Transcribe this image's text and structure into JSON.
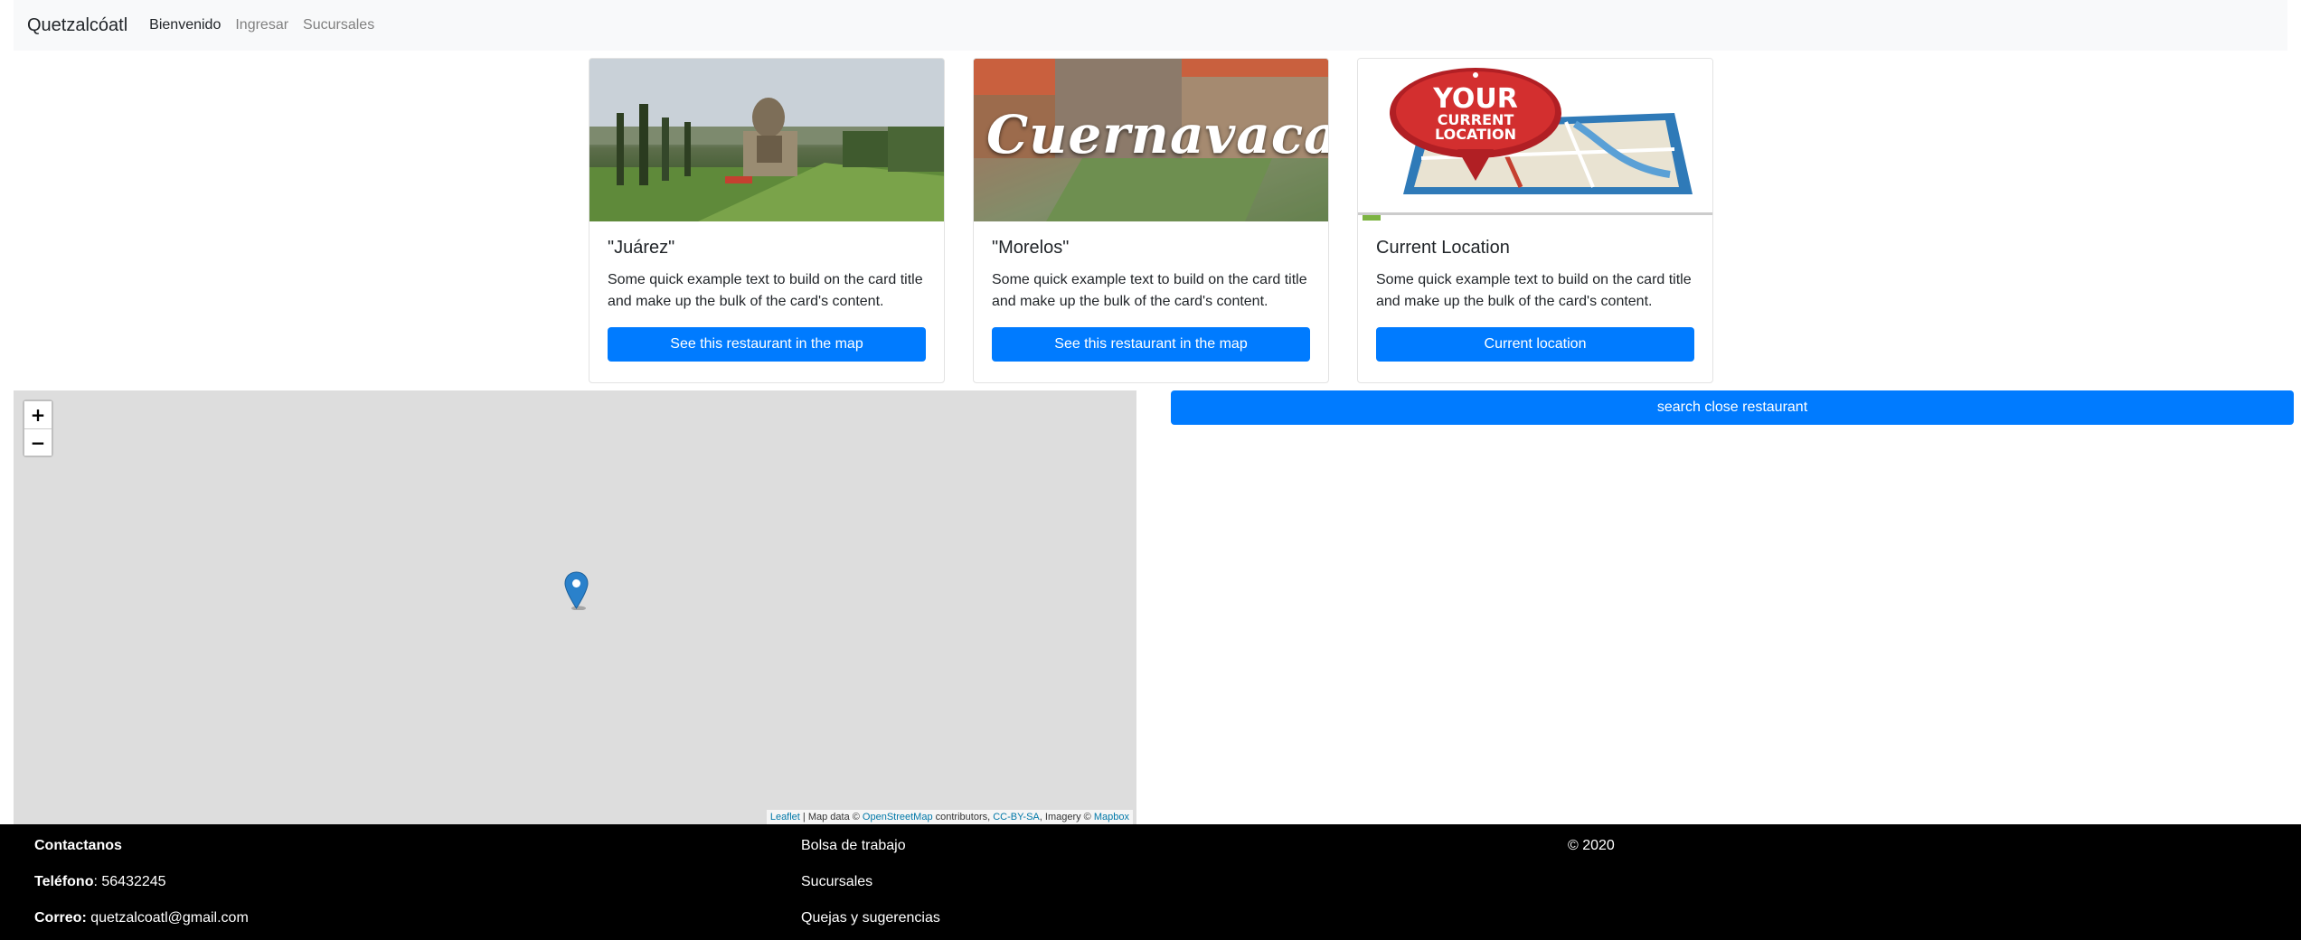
{
  "navbar": {
    "brand": "Quetzalcóatl",
    "links": [
      {
        "label": "Bienvenido"
      },
      {
        "label": "Ingresar"
      },
      {
        "label": "Sucursales"
      }
    ]
  },
  "cards": [
    {
      "title": "\"Juárez\"",
      "text": "Some quick example text to build on the card title and make up the bulk of the card's content.",
      "button": "See this restaurant in the map"
    },
    {
      "title": "\"Morelos\"",
      "image_text": "Cuernavaca",
      "text": "Some quick example text to build on the card title and make up the bulk of the card's content.",
      "button": "See this restaurant in the map"
    },
    {
      "title": "Current Location",
      "image_text_lines": [
        "YOUR",
        "CURRENT",
        "LOCATION"
      ],
      "text": "Some quick example text to build on the card title and make up the bulk of the card's content.",
      "button": "Current location"
    }
  ],
  "search_button": "search close restaurant",
  "map": {
    "zoom_in": "+",
    "zoom_out": "−",
    "attribution": {
      "leaflet": "Leaflet",
      "sep1": " | Map data © ",
      "osm": "OpenStreetMap",
      "contributors": " contributors, ",
      "license": "CC-BY-SA",
      "imagery": ", Imagery © ",
      "mapbox": "Mapbox"
    }
  },
  "footer": {
    "contact": {
      "heading": "Contactanos",
      "phone_label": "Teléfono",
      "phone_value": ": 56432245",
      "email_label": "Correo:",
      "email_value": " quetzalcoatl@gmail.com"
    },
    "links": [
      "Bolsa de trabajo",
      "Sucursales",
      "Quejas y sugerencias"
    ],
    "copyright": "© 2020"
  },
  "colors": {
    "primary": "#007bff",
    "navbar_bg": "#f8f9fa",
    "map_bg": "#dddddd",
    "footer_bg": "#000000"
  }
}
